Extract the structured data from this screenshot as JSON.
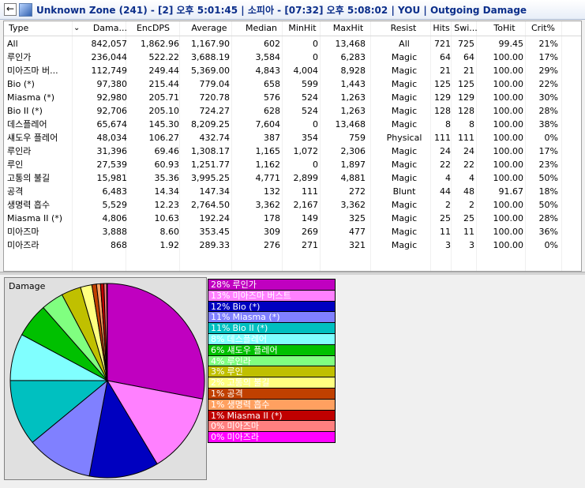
{
  "titlebar": {
    "title": "Unknown Zone (241) - [2] 오후 5:01:45 | 소피아 - [07:32] 오후 5:08:02 | YOU | Outgoing Damage",
    "back_glyph": "←",
    "icon": "app-icon"
  },
  "table": {
    "headers": [
      "Type",
      "Dama...",
      "EncDPS",
      "Average",
      "Median",
      "MinHit",
      "MaxHit",
      "Resist",
      "Hits",
      "Swi...",
      "ToHit",
      "Crit%"
    ],
    "sort_glyph": "⌄",
    "rows": [
      [
        "All",
        "842,057",
        "1,862.96",
        "1,167.90",
        "602",
        "0",
        "13,468",
        "All",
        "721",
        "725",
        "99.45",
        "21%"
      ],
      [
        "루인가",
        "236,044",
        "522.22",
        "3,688.19",
        "3,584",
        "0",
        "6,283",
        "Magic",
        "64",
        "64",
        "100.00",
        "17%"
      ],
      [
        "미아즈마 버...",
        "112,749",
        "249.44",
        "5,369.00",
        "4,843",
        "4,004",
        "8,928",
        "Magic",
        "21",
        "21",
        "100.00",
        "29%"
      ],
      [
        "Bio (*)",
        "97,380",
        "215.44",
        "779.04",
        "658",
        "599",
        "1,443",
        "Magic",
        "125",
        "125",
        "100.00",
        "22%"
      ],
      [
        "Miasma (*)",
        "92,980",
        "205.71",
        "720.78",
        "576",
        "524",
        "1,263",
        "Magic",
        "129",
        "129",
        "100.00",
        "30%"
      ],
      [
        "Bio II (*)",
        "92,706",
        "205.10",
        "724.27",
        "628",
        "524",
        "1,263",
        "Magic",
        "128",
        "128",
        "100.00",
        "28%"
      ],
      [
        "데스플레어",
        "65,674",
        "145.30",
        "8,209.25",
        "7,604",
        "0",
        "13,468",
        "Magic",
        "8",
        "8",
        "100.00",
        "38%"
      ],
      [
        "섀도우 플레어",
        "48,034",
        "106.27",
        "432.74",
        "387",
        "354",
        "759",
        "Physical",
        "111",
        "111",
        "100.00",
        "0%"
      ],
      [
        "루인라",
        "31,396",
        "69.46",
        "1,308.17",
        "1,165",
        "1,072",
        "2,306",
        "Magic",
        "24",
        "24",
        "100.00",
        "17%"
      ],
      [
        "루인",
        "27,539",
        "60.93",
        "1,251.77",
        "1,162",
        "0",
        "1,897",
        "Magic",
        "22",
        "22",
        "100.00",
        "23%"
      ],
      [
        "고통의 불길",
        "15,981",
        "35.36",
        "3,995.25",
        "4,771",
        "2,899",
        "4,881",
        "Magic",
        "4",
        "4",
        "100.00",
        "50%"
      ],
      [
        "공격",
        "6,483",
        "14.34",
        "147.34",
        "132",
        "111",
        "272",
        "Blunt",
        "44",
        "48",
        "91.67",
        "18%"
      ],
      [
        "생명력 흡수",
        "5,529",
        "12.23",
        "2,764.50",
        "3,362",
        "2,167",
        "3,362",
        "Magic",
        "2",
        "2",
        "100.00",
        "50%"
      ],
      [
        "Miasma II (*)",
        "4,806",
        "10.63",
        "192.24",
        "178",
        "149",
        "325",
        "Magic",
        "25",
        "25",
        "100.00",
        "28%"
      ],
      [
        "미아즈마",
        "3,888",
        "8.60",
        "353.45",
        "309",
        "269",
        "477",
        "Magic",
        "11",
        "11",
        "100.00",
        "36%"
      ],
      [
        "미아즈라",
        "868",
        "1.92",
        "289.33",
        "276",
        "271",
        "321",
        "Magic",
        "3",
        "3",
        "100.00",
        "0%"
      ]
    ]
  },
  "chart": {
    "title": "Damage",
    "legend": [
      {
        "pct": "28%",
        "label": "루인가",
        "color": "#c000c0"
      },
      {
        "pct": "13%",
        "label": "미아즈마 버스트",
        "color": "#ff80ff"
      },
      {
        "pct": "12%",
        "label": "Bio (*)",
        "color": "#0000c0"
      },
      {
        "pct": "11%",
        "label": "Miasma (*)",
        "color": "#8080ff"
      },
      {
        "pct": "11%",
        "label": "Bio II (*)",
        "color": "#00c0c0"
      },
      {
        "pct": "8%",
        "label": "데스플레어",
        "color": "#80ffff"
      },
      {
        "pct": "6%",
        "label": "섀도우 플레어",
        "color": "#00c000"
      },
      {
        "pct": "4%",
        "label": "루인라",
        "color": "#80ff80"
      },
      {
        "pct": "3%",
        "label": "루인",
        "color": "#c0c000"
      },
      {
        "pct": "2%",
        "label": "고통의 불길",
        "color": "#ffff80"
      },
      {
        "pct": "1%",
        "label": "공격",
        "color": "#c04000"
      },
      {
        "pct": "1%",
        "label": "생명력 흡수",
        "color": "#ffa060"
      },
      {
        "pct": "1%",
        "label": "Miasma II (*)",
        "color": "#c00000"
      },
      {
        "pct": "0%",
        "label": "미아즈마",
        "color": "#ff8080"
      },
      {
        "pct": "0%",
        "label": "미아즈라",
        "color": "#ff00ff"
      }
    ]
  },
  "chart_data": {
    "type": "pie",
    "title": "Damage",
    "categories": [
      "루인가",
      "미아즈마 버스트",
      "Bio (*)",
      "Miasma (*)",
      "Bio II (*)",
      "데스플레어",
      "섀도우 플레어",
      "루인라",
      "루인",
      "고통의 불길",
      "공격",
      "생명력 흡수",
      "Miasma II (*)",
      "미아즈마",
      "미아즈라"
    ],
    "values": [
      236044,
      112749,
      97380,
      92980,
      92706,
      65674,
      48034,
      31396,
      27539,
      15981,
      6483,
      5529,
      4806,
      3888,
      868
    ],
    "colors": [
      "#c000c0",
      "#ff80ff",
      "#0000c0",
      "#8080ff",
      "#00c0c0",
      "#80ffff",
      "#00c000",
      "#80ff80",
      "#c0c000",
      "#ffff80",
      "#c04000",
      "#ffa060",
      "#c00000",
      "#ff8080",
      "#ff00ff"
    ]
  }
}
